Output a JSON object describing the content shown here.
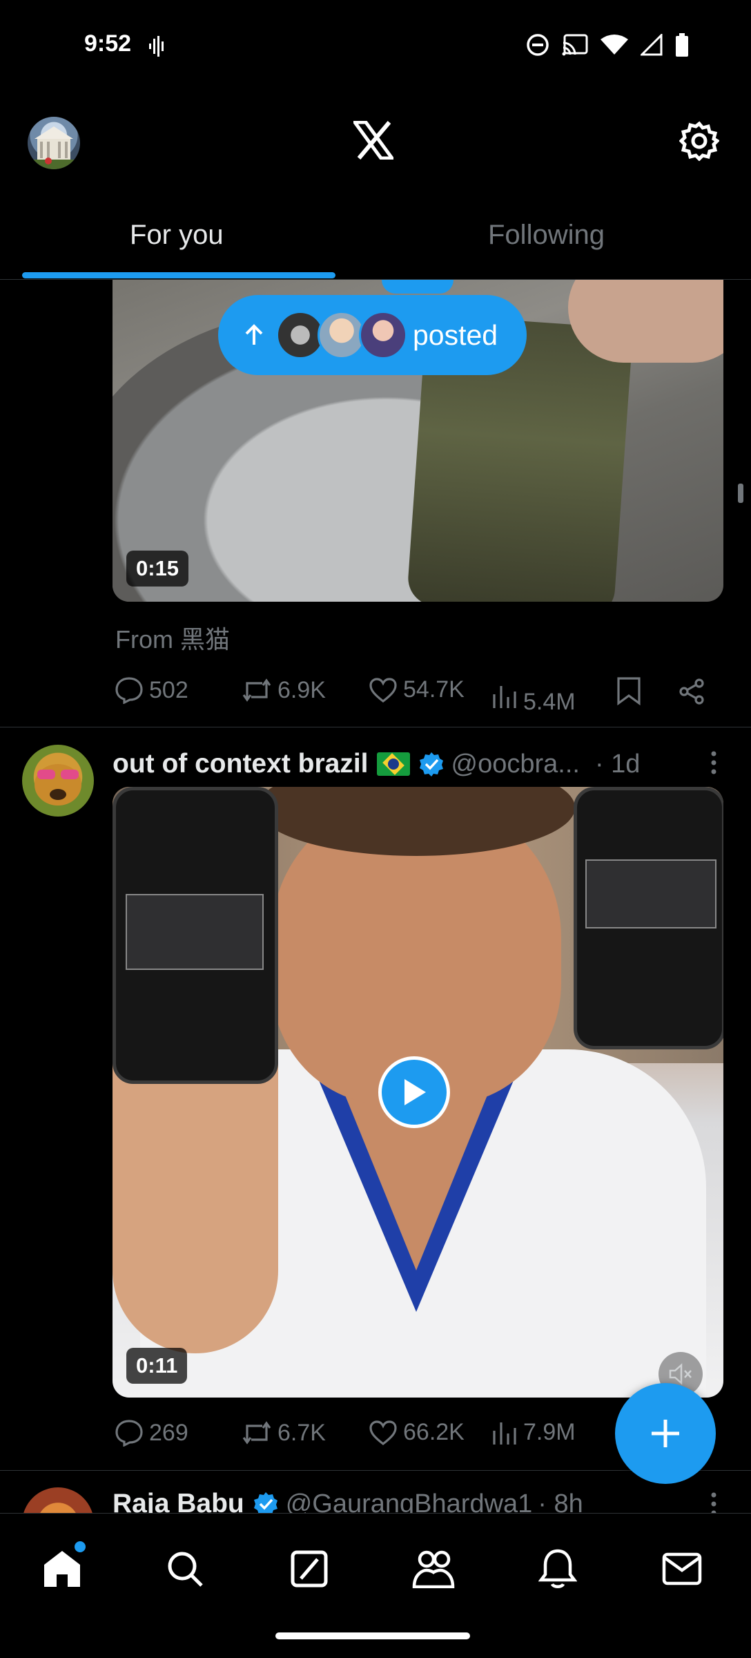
{
  "status_bar": {
    "time": "9:52"
  },
  "tabs": [
    {
      "label": "For you",
      "selected": true
    },
    {
      "label": "Following",
      "selected": false
    }
  ],
  "new_posts_pill": {
    "label": "posted"
  },
  "tweet1": {
    "video_duration": "0:15",
    "from_label": "From 黑猫",
    "stats": {
      "replies": "502",
      "reposts": "6.9K",
      "likes": "54.7K",
      "views": "5.4M"
    }
  },
  "tweet2": {
    "display_name": "out of context brazil",
    "handle": "@oocbra...",
    "timestamp": "· 1d",
    "video_duration": "0:11",
    "stats": {
      "replies": "269",
      "reposts": "6.7K",
      "likes": "66.2K",
      "views": "7.9M"
    }
  },
  "tweet3": {
    "display_name": "Raja Babu",
    "handle": "@GaurangBhardwa1",
    "timestamp": "· 8h"
  },
  "colors": {
    "accent": "#1d9bf0",
    "background": "#000000",
    "secondary_text": "#71767b"
  },
  "bottom_nav": [
    {
      "icon": "home-icon",
      "active": true,
      "has_badge": true
    },
    {
      "icon": "search-icon",
      "active": false
    },
    {
      "icon": "grok-icon",
      "active": false
    },
    {
      "icon": "communities-icon",
      "active": false
    },
    {
      "icon": "notifications-icon",
      "active": false
    },
    {
      "icon": "messages-icon",
      "active": false
    }
  ]
}
